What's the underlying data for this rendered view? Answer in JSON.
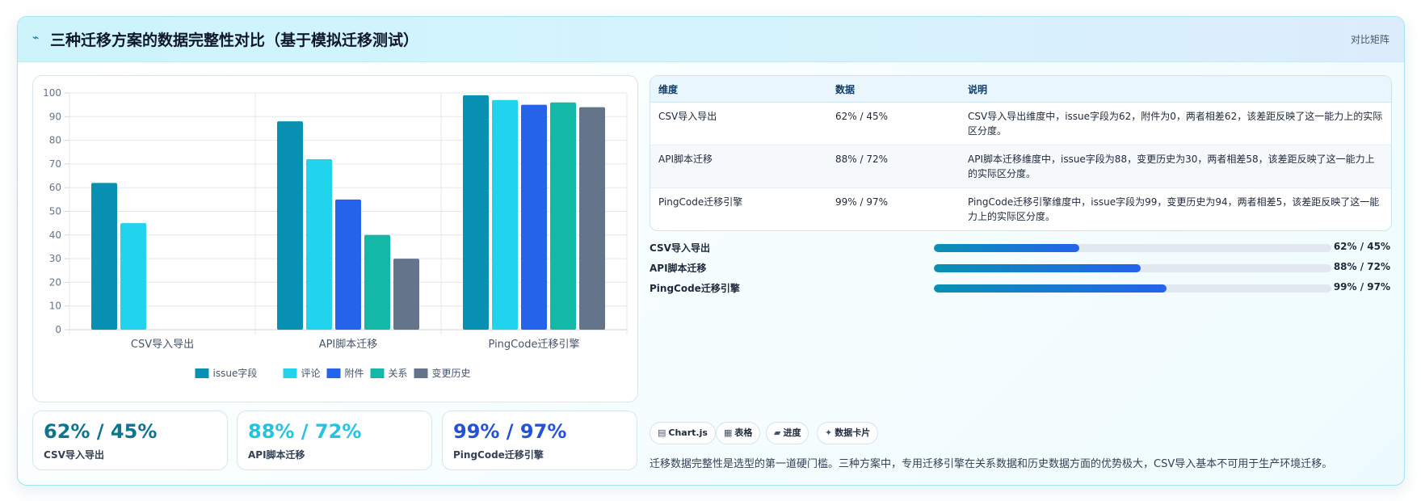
{
  "header": {
    "icon": "bolt-icon",
    "title": "三种迁移方案的数据完整性对比（基于模拟迁移测试）",
    "tag": "对比矩阵"
  },
  "chart_data": {
    "type": "bar",
    "title": "",
    "xlabel": "",
    "ylabel": "",
    "ylim": [
      0,
      100
    ],
    "yticks": [
      0,
      10,
      20,
      30,
      40,
      50,
      60,
      70,
      80,
      90,
      100
    ],
    "grid": true,
    "legend_position": "bottom",
    "categories": [
      "CSV导入导出",
      "API脚本迁移",
      "PingCode迁移引擎"
    ],
    "series": [
      {
        "name": "issue字段",
        "color": "#0891b2",
        "values": [
          62,
          88,
          99
        ]
      },
      {
        "name": "评论",
        "color": "#22d3ee",
        "values": [
          45,
          72,
          97
        ]
      },
      {
        "name": "附件",
        "color": "#2563eb",
        "values": [
          0,
          55,
          95
        ]
      },
      {
        "name": "关系",
        "color": "#14b8a6",
        "values": [
          0,
          40,
          96
        ]
      },
      {
        "name": "变更历史",
        "color": "#64748b",
        "values": [
          0,
          30,
          94
        ]
      }
    ]
  },
  "stats": [
    {
      "value": "62% / 45%",
      "label": "CSV导入导出",
      "color": "#0e7490"
    },
    {
      "value": "88% / 72%",
      "label": "API脚本迁移",
      "color": "#22c5e0"
    },
    {
      "value": "99% / 97%",
      "label": "PingCode迁移引擎",
      "color": "#2553d8"
    }
  ],
  "table": {
    "headers": [
      "维度",
      "数据",
      "说明"
    ],
    "rows": [
      {
        "dim": "CSV导入导出",
        "data": "62% / 45%",
        "desc": "CSV导入导出维度中，issue字段为62，附件为0，两者相差62，该差距反映了这一能力上的实际区分度。"
      },
      {
        "dim": "API脚本迁移",
        "data": "88% / 72%",
        "desc": "API脚本迁移维度中，issue字段为88，变更历史为30，两者相差58，该差距反映了这一能力上的实际区分度。"
      },
      {
        "dim": "PingCode迁移引擎",
        "data": "99% / 97%",
        "desc": "PingCode迁移引擎维度中，issue字段为99，变更历史为94，两者相差5，该差距反映了这一能力上的实际区分度。"
      }
    ]
  },
  "progress": [
    {
      "label": "CSV导入导出",
      "value": "62% / 45%",
      "fraction": 0.365
    },
    {
      "label": "API脚本迁移",
      "value": "88% / 72%",
      "fraction": 0.52
    },
    {
      "label": "PingCode迁移引擎",
      "value": "99% / 97%",
      "fraction": 0.585
    }
  ],
  "chips": [
    {
      "icon": "▤",
      "icon_name": "chart-icon",
      "label": "Chart.js"
    },
    {
      "icon": "▦",
      "icon_name": "table-icon",
      "label": "表格"
    },
    {
      "icon": "▰",
      "icon_name": "progress-icon",
      "label": "进度"
    },
    {
      "icon": "✦",
      "icon_name": "card-icon",
      "label": "数据卡片"
    }
  ],
  "summary": "迁移数据完整性是选型的第一道硬门槛。三种方案中，专用迁移引擎在关系数据和历史数据方面的优势极大，CSV导入基本不可用于生产环境迁移。"
}
